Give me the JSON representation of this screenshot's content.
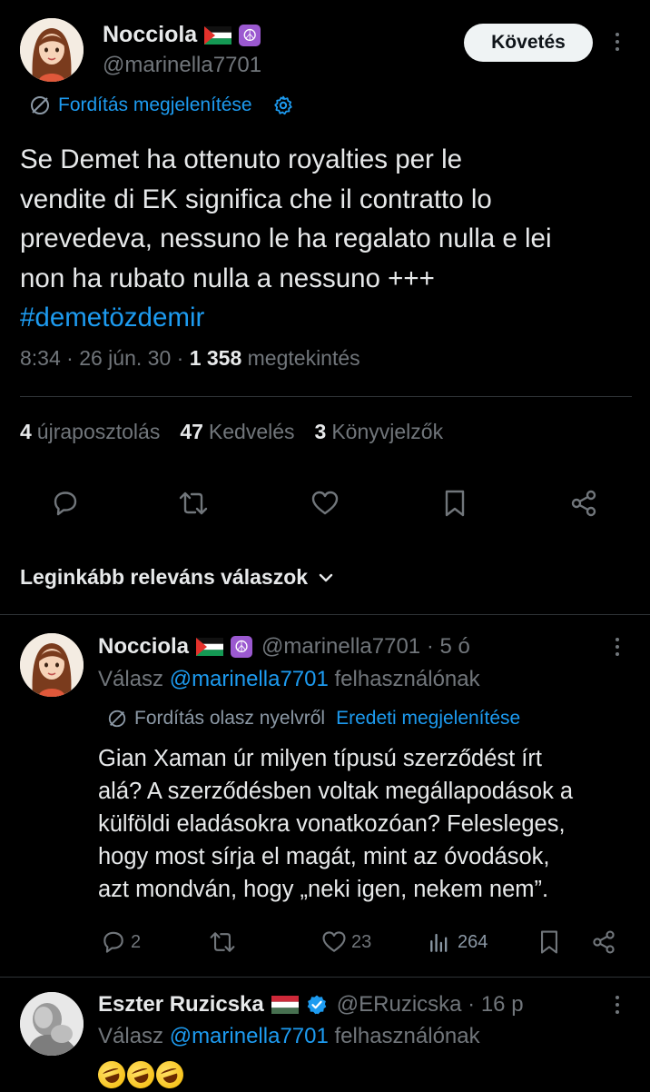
{
  "main_tweet": {
    "author_name": "Nocciola",
    "handle": "@marinella7701",
    "follow_label": "Követés",
    "translate_label": "Fordítás megjelenítése",
    "text_lines": [
      "Se Demet ha ottenuto royalties per le",
      "vendite di EK  significa che il contratto lo",
      "prevedeva, nessuno le ha regalato nulla e lei",
      "non ha rubato nulla a nessuno +++"
    ],
    "hashtag": "#demetözdemir",
    "time": "8:34 · 26 jún. 30 · ",
    "views_count": "1 358",
    "views_label": " megtekintés",
    "reposts_count": "4",
    "reposts_label": "újraposztolás",
    "likes_count": "47",
    "likes_label": "Kedvelés",
    "bookmarks_count": "3",
    "bookmarks_label": "Könyvjelzők"
  },
  "sort": {
    "label": "Leginkább releváns válaszok"
  },
  "replies": [
    {
      "author_name": "Nocciola",
      "handle_time": "@marinella7701 · 5 ó",
      "reply_prefix": "Válasz ",
      "reply_handle": "@marinella7701",
      "reply_suffix": " felhasználónak",
      "translate_label": "Fordítás olasz nyelvről",
      "original_label": "Eredeti megjelenítése",
      "text_lines": [
        "Gian Xaman úr milyen típusú szerződést írt",
        "alá? A szerződésben voltak megállapodások a",
        "külföldi eladásokra vonatkozóan? Felesleges,",
        "hogy most sírja el magát, mint az óvodások,",
        "azt mondván, hogy „neki igen, nekem nem”."
      ],
      "replies_count": "2",
      "reposts_count": "",
      "likes_count": "23",
      "views_count": "264"
    },
    {
      "author_name": "Eszter Ruzicska",
      "handle_time": "@ERuzicska · 16 p",
      "reply_prefix": "Válasz ",
      "reply_handle": "@marinella7701",
      "reply_suffix": " felhasználónak"
    }
  ],
  "icons": {
    "translate": "globe-slash-icon",
    "settings": "gear-icon",
    "reply": "chat-bubble-icon",
    "repost": "repost-arrows-icon",
    "like": "heart-icon",
    "bookmark": "bookmark-icon",
    "share": "share-icon",
    "views": "bar-chart-icon",
    "more": "vertical-dots-icon",
    "chevron": "chevron-down-icon",
    "verified": "verified-badge-icon"
  },
  "colors": {
    "background": "#000000",
    "text": "#e7e9ea",
    "secondary": "#71767b",
    "accent": "#1d9bf0",
    "divider": "#2f3336",
    "follow_bg": "#eff3f4"
  }
}
